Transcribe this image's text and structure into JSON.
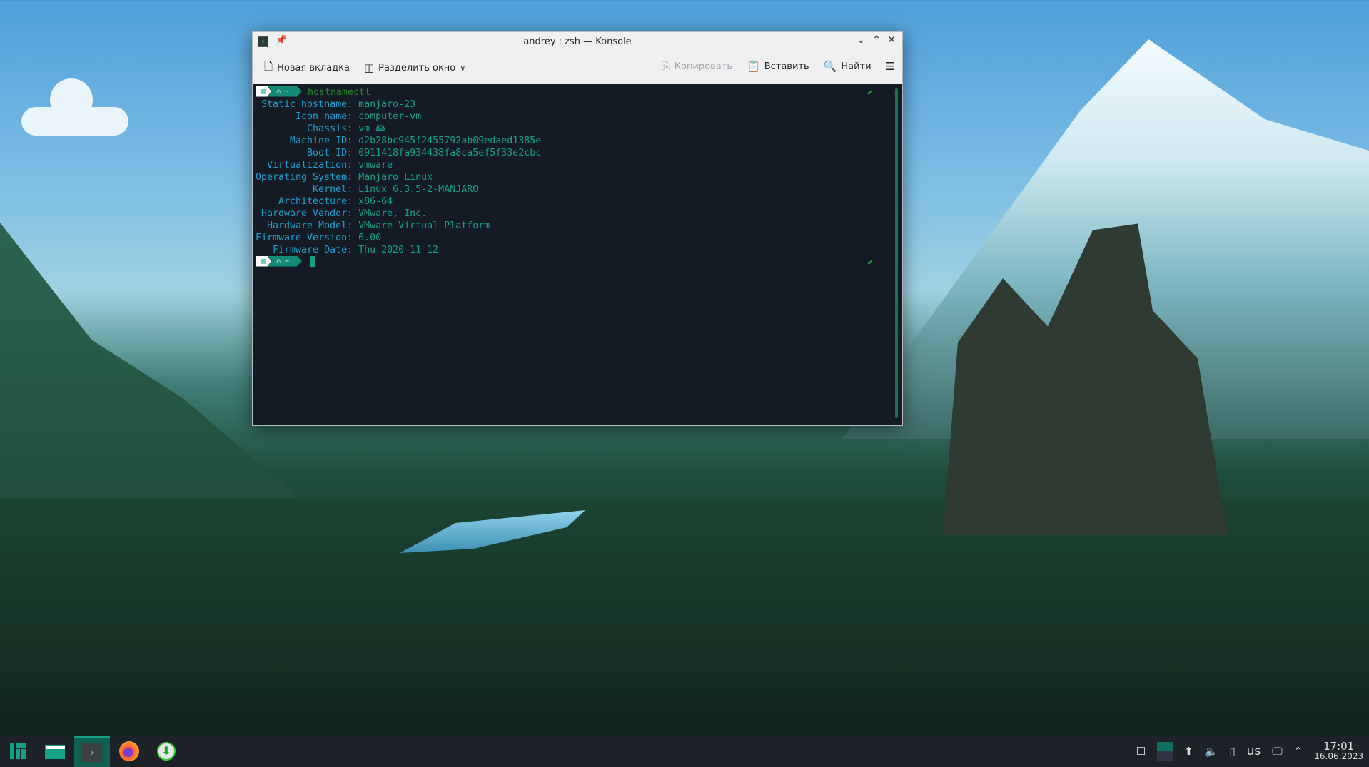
{
  "window": {
    "title": "andrey : zsh — Konsole"
  },
  "toolbar": {
    "new_tab": "Новая вкладка",
    "split_view": "Разделить окно",
    "copy": "Копировать",
    "paste": "Вставить",
    "find": "Найти"
  },
  "terminal": {
    "prompt_dir": "~",
    "command": "hostnamectl",
    "check": "✔",
    "rows": [
      {
        "key": " Static hostname: ",
        "value": "manjaro-23"
      },
      {
        "key": "       Icon name: ",
        "value": "computer-vm"
      },
      {
        "key": "         Chassis: ",
        "value": "vm 🖴"
      },
      {
        "key": "      Machine ID: ",
        "value": "d2b28bc945f2455792ab09edaed1385e"
      },
      {
        "key": "         Boot ID: ",
        "value": "0911418fa934438fa8ca5ef5f33e2cbc"
      },
      {
        "key": "  Virtualization: ",
        "value": "vmware"
      },
      {
        "key": "Operating System: ",
        "value": "Manjaro Linux"
      },
      {
        "key": "          Kernel: ",
        "value": "Linux 6.3.5-2-MANJARO"
      },
      {
        "key": "    Architecture: ",
        "value": "x86-64"
      },
      {
        "key": " Hardware Vendor: ",
        "value": "VMware, Inc."
      },
      {
        "key": "  Hardware Model: ",
        "value": "VMware Virtual Platform"
      },
      {
        "key": "Firmware Version: ",
        "value": "6.00"
      },
      {
        "key": "   Firmware Date: ",
        "value": "Thu 2020-11-12"
      }
    ]
  },
  "tray": {
    "keyboard_layout": "us",
    "time": "17:01",
    "date": "16.06.2023"
  },
  "colors": {
    "accent": "#16a085",
    "terminal_bg": "#141b24",
    "key": "#1e9fd0"
  }
}
